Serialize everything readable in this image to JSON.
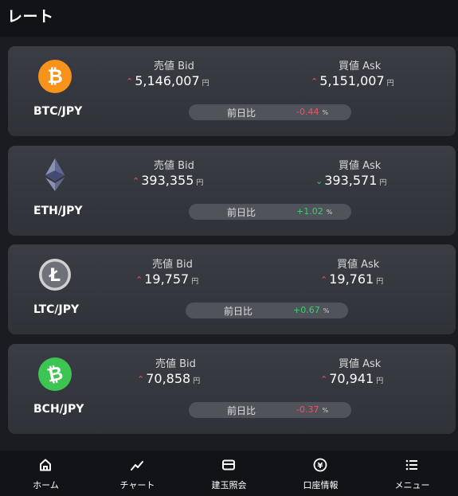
{
  "header": {
    "title": "レート"
  },
  "rates": [
    {
      "pair": "BTC/JPY",
      "icon": "bitcoin-icon",
      "icon_color": "#f7931a",
      "bid_label": "売値 Bid",
      "ask_label": "買値 Ask",
      "bid": "5,146,007",
      "ask": "5,151,007",
      "unit": "円",
      "bid_dir": "up",
      "ask_dir": "up",
      "change_label": "前日比",
      "change": "-0.44",
      "change_unit": "%",
      "change_sign": "neg"
    },
    {
      "pair": "ETH/JPY",
      "icon": "ethereum-icon",
      "icon_color": "#8a92b2",
      "bid_label": "売値 Bid",
      "ask_label": "買値 Ask",
      "bid": "393,355",
      "ask": "393,571",
      "unit": "円",
      "bid_dir": "up",
      "ask_dir": "down",
      "change_label": "前日比",
      "change": "+1.02",
      "change_unit": "%",
      "change_sign": "pos"
    },
    {
      "pair": "LTC/JPY",
      "icon": "litecoin-icon",
      "icon_color": "#d0d0d0",
      "bid_label": "売値 Bid",
      "ask_label": "買値 Ask",
      "bid": "19,757",
      "ask": "19,761",
      "unit": "円",
      "bid_dir": "up",
      "ask_dir": "up",
      "change_label": "前日比",
      "change": "+0.67",
      "change_unit": "%",
      "change_sign": "pos"
    },
    {
      "pair": "BCH/JPY",
      "icon": "bitcoin-cash-icon",
      "icon_color": "#3cc553",
      "bid_label": "売値 Bid",
      "ask_label": "買値 Ask",
      "bid": "70,858",
      "ask": "70,941",
      "unit": "円",
      "bid_dir": "up",
      "ask_dir": "up",
      "change_label": "前日比",
      "change": "-0.37",
      "change_unit": "%",
      "change_sign": "neg"
    }
  ],
  "bottom_nav": [
    {
      "label": "ホーム",
      "icon": "home-icon"
    },
    {
      "label": "チャート",
      "icon": "chart-icon"
    },
    {
      "label": "建玉照会",
      "icon": "wallet-icon"
    },
    {
      "label": "口座情報",
      "icon": "yen-icon"
    },
    {
      "label": "メニュー",
      "icon": "menu-icon"
    }
  ]
}
